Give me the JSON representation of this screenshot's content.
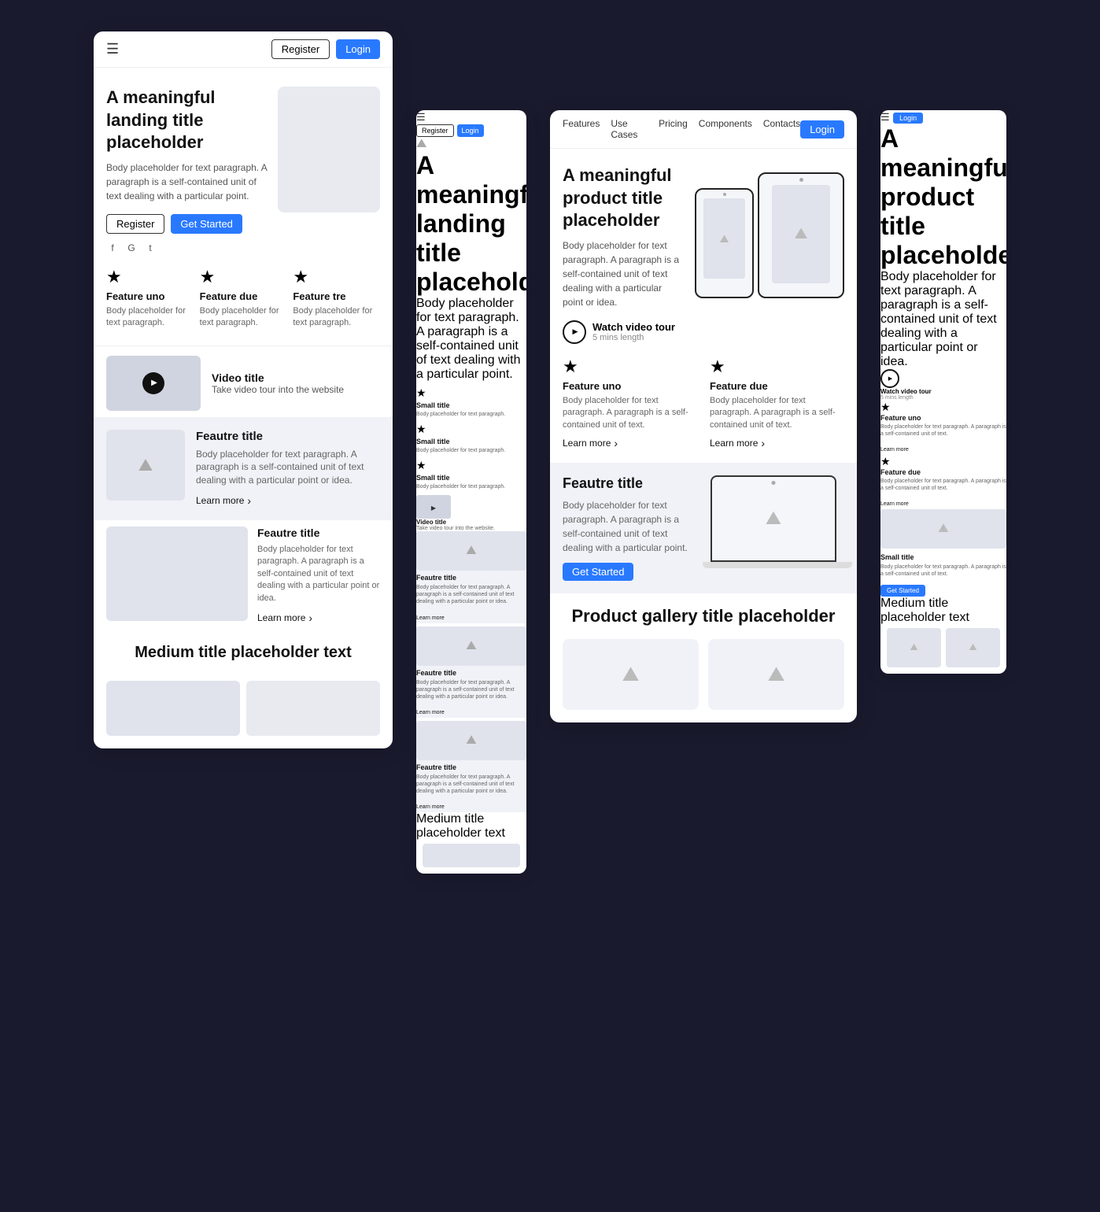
{
  "page": {
    "bg": "#1a1a2e"
  },
  "device1": {
    "nav": {
      "register": "Register",
      "login": "Login"
    },
    "hero": {
      "title": "A meaningful landing title placeholder",
      "body": "Body placeholder for text paragraph. A paragraph is a self-contained unit of text dealing with a particular point.",
      "register": "Register",
      "get_started": "Get Started"
    },
    "features": [
      {
        "label": "Feature uno",
        "body": "Body placeholder for text paragraph."
      },
      {
        "label": "Feature due",
        "body": "Body placeholder for text paragraph."
      },
      {
        "label": "Feature tre",
        "body": "Body placeholder for text paragraph."
      }
    ],
    "video": {
      "title": "Video title",
      "subtitle": "Take video tour into the website"
    },
    "feature_card": {
      "title": "Feautre title",
      "body": "Body placeholder for text paragraph. A paragraph is a self-contained unit of text dealing with a particular point or idea.",
      "learn_more": "Learn more"
    },
    "feature_card2": {
      "title": "Feautre title",
      "body": "Body placeholder for text paragraph. A paragraph is a self-contained unit of text dealing with a particular point or idea.",
      "learn_more": "Learn more"
    },
    "medium_title": "Medium title placeholder text"
  },
  "device2": {
    "nav": {
      "register": "Register",
      "login": "Login"
    },
    "hero": {
      "title": "A meaningful landing title placeholder",
      "body": "Body placeholder for text paragraph. A paragraph is a self-contained unit of text dealing with a particular point."
    },
    "small_titles": [
      {
        "title": "Small title",
        "body": "Body placeholder for text paragraph."
      },
      {
        "title": "Small title",
        "body": "Body placeholder for text paragraph."
      },
      {
        "title": "Small title",
        "body": "Body placeholder for text paragraph."
      }
    ],
    "video": {
      "title": "Video title",
      "subtitle": "Take video tour into the website."
    },
    "feature_cards": [
      {
        "title": "Feautre title",
        "body": "Body placeholder for text paragraph. A paragraph is a self-contained unit of text dealing with a particular point or idea.",
        "learn_more": "Learn more"
      },
      {
        "title": "Feautre title",
        "body": "Body placeholder for text paragraph. A paragraph is a self-contained unit of text dealing with a particular point or idea.",
        "learn_more": "Learn more"
      },
      {
        "title": "Feautre title",
        "body": "Body placeholder for text paragraph. A paragraph is a self-contained unit of text dealing with a particular point or idea.",
        "learn_more": "Learn more"
      }
    ],
    "medium_title": "Medium title placeholder text"
  },
  "device3": {
    "nav": {
      "links": [
        "Features",
        "Use Cases",
        "Pricing",
        "Components",
        "Contacts"
      ],
      "login": "Login"
    },
    "hero": {
      "title": "A meaningful product title placeholder",
      "body": "Body placeholder for text paragraph. A paragraph is a self-contained unit of text dealing with a particular point or idea.",
      "watch_label": "Watch video tour",
      "watch_sub": "5 mins length"
    },
    "features": [
      {
        "label": "Feature uno",
        "body": "Body placeholder for text paragraph. A paragraph is a self-contained unit of text.",
        "learn_more": "Learn more"
      },
      {
        "label": "Feature due",
        "body": "Body placeholder for text paragraph. A paragraph is a self-contained unit of text.",
        "learn_more": "Learn more"
      }
    ],
    "feature_banner": {
      "title": "Feautre title",
      "body": "Body placeholder for text paragraph. A paragraph is a self-contained unit of text dealing with a particular point.",
      "get_started": "Get Started"
    },
    "gallery": {
      "title": "Product gallery title placeholder"
    },
    "learn_more": "Learn more"
  },
  "device4": {
    "nav": {
      "login": "Login"
    },
    "hero": {
      "title": "A meaningful product title placeholder",
      "body": "Body placeholder for text paragraph. A paragraph is a self-contained unit of text dealing with a particular point or idea.",
      "watch_label": "Watch video tour",
      "watch_sub": "5 mins length"
    },
    "features": [
      {
        "label": "Feature uno",
        "body": "Body placeholder for text paragraph. A paragraph is a self-contained unit of text.",
        "learn_more": "Learn more"
      },
      {
        "label": "Feature due",
        "body": "Body placeholder for text paragraph. A paragraph is a self-contained unit of text.",
        "learn_more": "Learn more"
      }
    ],
    "small_section": {
      "title": "Small title",
      "body": "Body placeholder for text paragraph. A paragraph is a self-contained unit of text.",
      "get_started": "Get Started"
    },
    "medium_title": "Medium title placeholder text"
  }
}
